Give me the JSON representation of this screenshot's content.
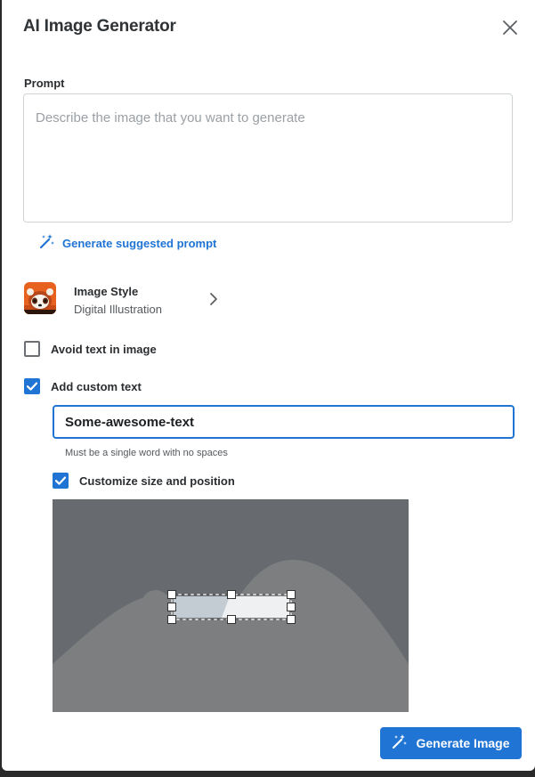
{
  "dialog": {
    "title": "AI Image Generator"
  },
  "prompt": {
    "label": "Prompt",
    "placeholder": "Describe the image that you want to generate",
    "value": "",
    "suggest_label": "Generate suggested prompt"
  },
  "style": {
    "name_label": "Image Style",
    "value": "Digital Illustration",
    "thumbnail_icon": "red-panda-thumbnail"
  },
  "options": {
    "avoid_text": {
      "label": "Avoid text in image",
      "checked": false
    },
    "custom_text": {
      "label": "Add custom text",
      "checked": true
    },
    "custom_text_value": "Some-awesome-text",
    "custom_text_helper": "Must be a single word with no spaces",
    "customize_position": {
      "label": "Customize size and position",
      "checked": true
    }
  },
  "footer": {
    "generate_label": "Generate Image"
  },
  "colors": {
    "accent": "#1f74d4",
    "canvas_bg": "#676a6e",
    "canvas_hill": "#7d7e80"
  }
}
